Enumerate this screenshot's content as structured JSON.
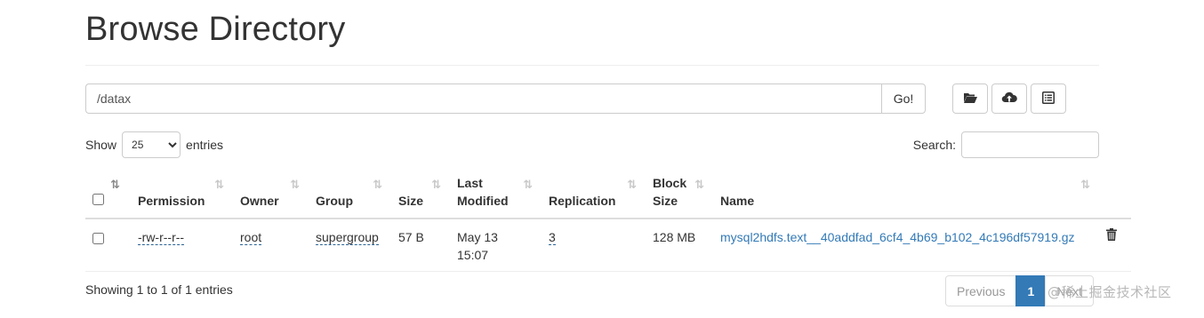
{
  "page": {
    "title": "Browse Directory"
  },
  "pathbar": {
    "value": "/datax",
    "go_label": "Go!"
  },
  "toolbar": [
    {
      "icon": "folder-open-icon"
    },
    {
      "icon": "cloud-upload-icon"
    },
    {
      "icon": "list-alt-icon"
    }
  ],
  "length_menu": {
    "prefix": "Show",
    "selected": "25",
    "suffix": "entries"
  },
  "search": {
    "label": "Search:",
    "value": ""
  },
  "table": {
    "columns": [
      {
        "line1": "",
        "line2": "Permission"
      },
      {
        "line1": "",
        "line2": "Owner"
      },
      {
        "line1": "",
        "line2": "Group"
      },
      {
        "line1": "",
        "line2": "Size"
      },
      {
        "line1": "Last",
        "line2": "Modified"
      },
      {
        "line1": "",
        "line2": "Replication"
      },
      {
        "line1": "Block",
        "line2": "Size"
      },
      {
        "line1": "",
        "line2": "Name"
      }
    ],
    "rows": [
      {
        "permission": "-rw-r--r--",
        "owner": "root",
        "group": "supergroup",
        "size": "57 B",
        "modified_date": "May 13",
        "modified_time": "15:07",
        "replication": "3",
        "block_size": "128 MB",
        "name": "mysql2hdfs.text__40addfad_6cf4_4b69_b102_4c196df57919.gz"
      }
    ]
  },
  "footer": {
    "info": "Showing 1 to 1 of 1 entries",
    "previous": "Previous",
    "current_page": "1",
    "next": "Next"
  },
  "watermark": "@稀土掘金技术社区",
  "colors": {
    "accent": "#337ab7",
    "border": "#cccccc"
  }
}
